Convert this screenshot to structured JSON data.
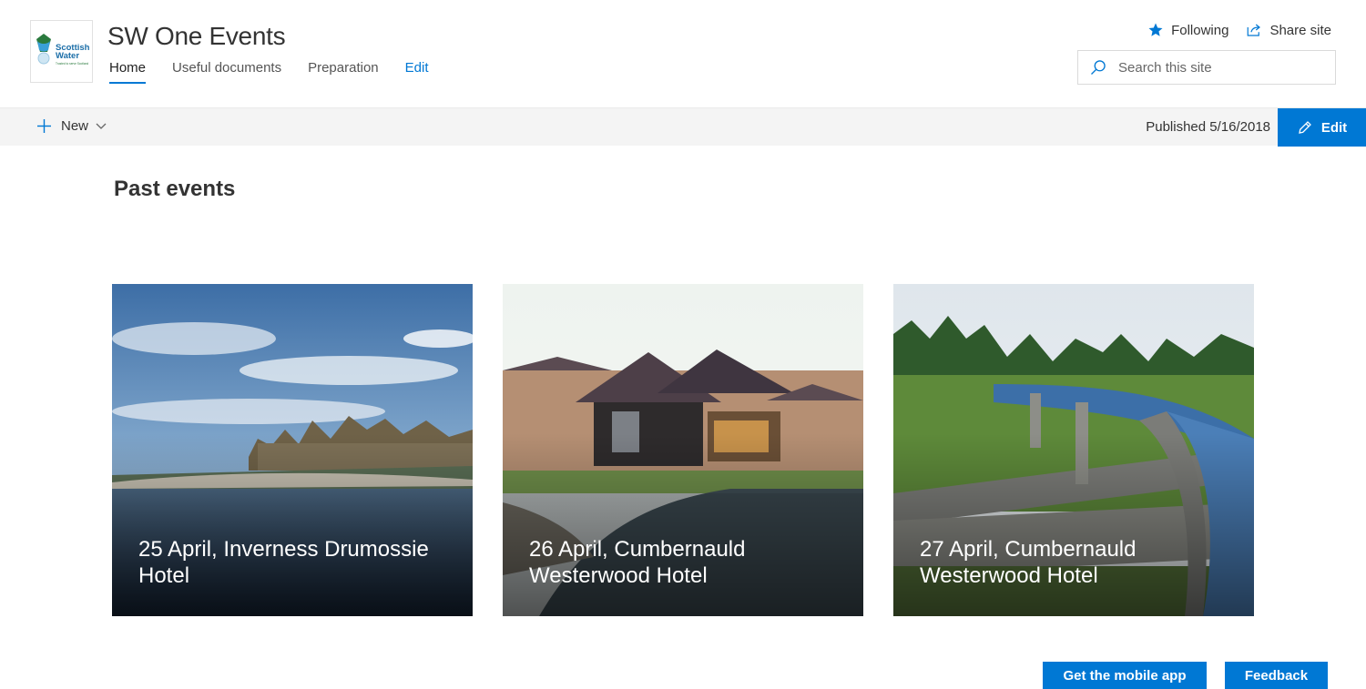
{
  "site": {
    "title": "SW One Events",
    "logo_text_line1": "Scottish",
    "logo_text_line2": "Water",
    "logo_tagline": "Trusted to serve Scotland"
  },
  "nav": {
    "items": [
      {
        "label": "Home",
        "active": true
      },
      {
        "label": "Useful documents",
        "active": false
      },
      {
        "label": "Preparation",
        "active": false
      },
      {
        "label": "Edit",
        "active": false
      }
    ]
  },
  "header_actions": {
    "following_label": "Following",
    "share_label": "Share site"
  },
  "search": {
    "placeholder": "Search this site"
  },
  "commandbar": {
    "new_label": "New",
    "published_text": "Published 5/16/2018",
    "edit_label": "Edit"
  },
  "main": {
    "section_title": "Past events",
    "cards": [
      {
        "caption": "25 April, Inverness Drumossie Hotel"
      },
      {
        "caption": "26 April, Cumbernauld Westerwood Hotel"
      },
      {
        "caption": "27 April, Cumbernauld Westerwood Hotel"
      }
    ]
  },
  "footer": {
    "mobile_app_label": "Get the mobile app",
    "feedback_label": "Feedback"
  },
  "colors": {
    "accent": "#0078d4",
    "commandbar_bg": "#f4f4f4"
  }
}
